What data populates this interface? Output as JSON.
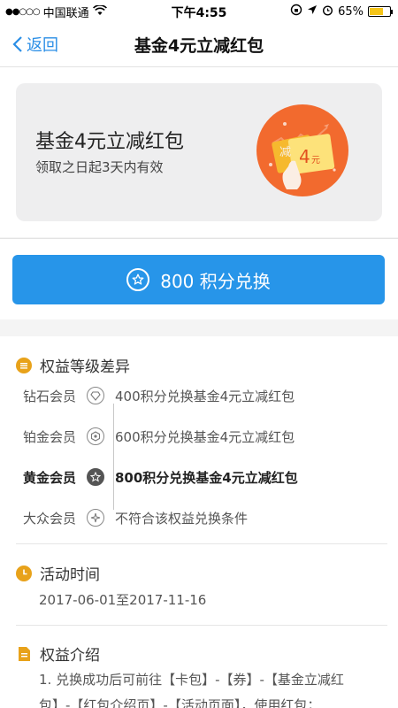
{
  "status_bar": {
    "signal": "●●○○○",
    "carrier": "中国联通",
    "time": "下午4:55",
    "battery": "65%"
  },
  "nav": {
    "back_label": "返回",
    "title": "基金4元立减红包"
  },
  "coupon": {
    "title": "基金4元立减红包",
    "subtitle": "领取之日起3天内有效",
    "art_amount": "4",
    "art_unit": "元",
    "art_char": "减"
  },
  "redeem": {
    "label": "800 积分兑换"
  },
  "tiers_section": {
    "title": "权益等级差异",
    "tiers": [
      {
        "name": "钻石会员",
        "desc": "400积分兑换基金4元立减红包"
      },
      {
        "name": "铂金会员",
        "desc": "600积分兑换基金4元立减红包"
      },
      {
        "name": "黄金会员",
        "desc": "800积分兑换基金4元立减红包"
      },
      {
        "name": "大众会员",
        "desc": "不符合该权益兑换条件"
      }
    ]
  },
  "activity": {
    "title": "活动时间",
    "period": "2017-06-01至2017-11-16"
  },
  "intro": {
    "title": "权益介绍",
    "line1": "1. 兑换成功后可前往【卡包】-【券】-【基金立减红",
    "line2": "包】-【红包介绍页】-【活动页面】，使用红包；"
  },
  "colors": {
    "accent": "#2795e9",
    "section_icon": "#e8a21a",
    "coupon_orange": "#f26a2e"
  }
}
